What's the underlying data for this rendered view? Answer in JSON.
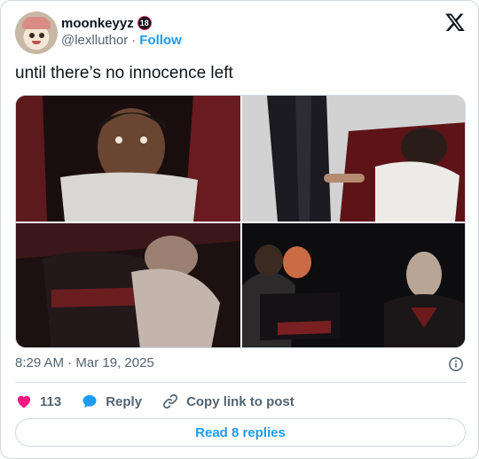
{
  "author": {
    "display_name": "moonkeyyz",
    "badge": "18",
    "handle": "@lexlluthor",
    "separator": "·",
    "follow_label": "Follow"
  },
  "tweet": {
    "text": "until there’s no innocence left",
    "timestamp": "8:29 AM · Mar 19, 2025"
  },
  "media": {
    "count": 4
  },
  "actions": {
    "like_count": "113",
    "reply_label": "Reply",
    "copy_label": "Copy link to post"
  },
  "footer": {
    "read_replies_label": "Read 8 replies"
  },
  "colors": {
    "accent": "#1d9bf0",
    "like": "#f91880",
    "text_primary": "#0f1419",
    "text_secondary": "#536471",
    "border": "#cfd9de"
  },
  "icons": [
    "x-logo-icon",
    "info-icon",
    "heart-icon",
    "reply-bubble-icon",
    "link-icon"
  ]
}
